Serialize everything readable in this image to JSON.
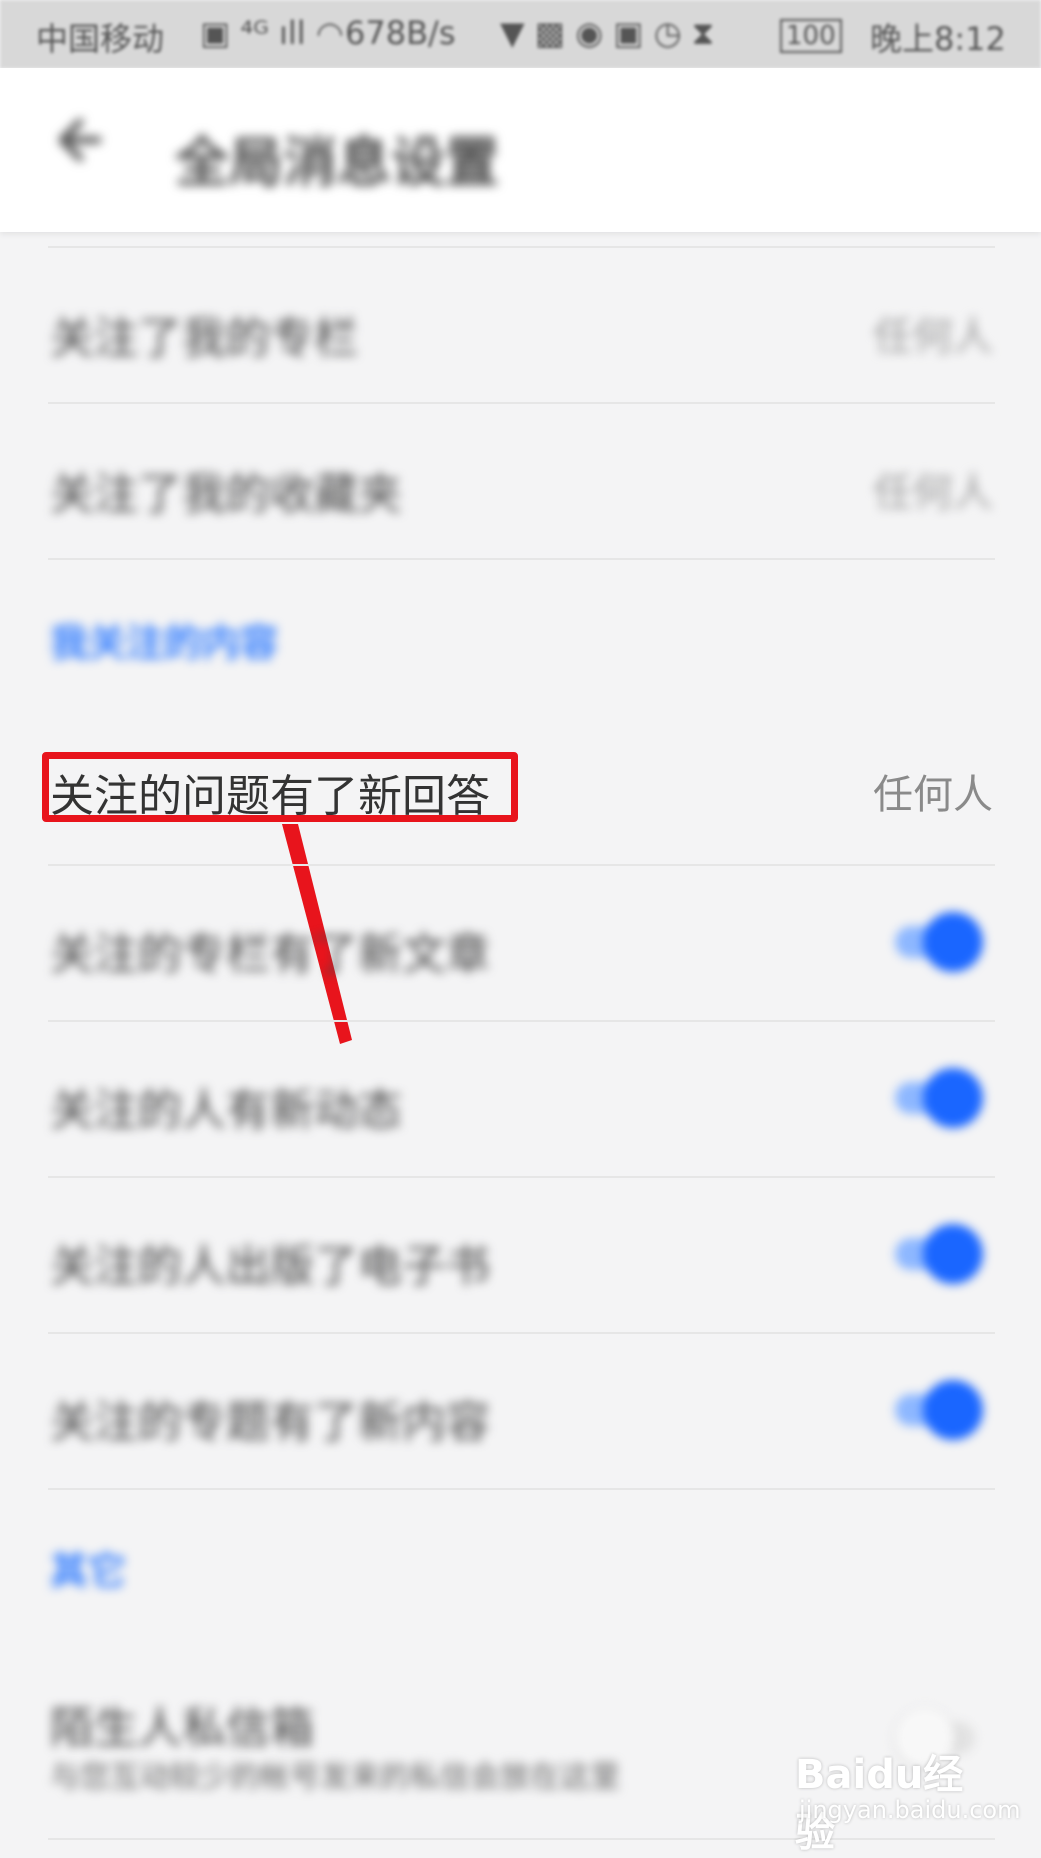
{
  "status_bar": {
    "carrier": "中国移动",
    "speed": "678B/s",
    "battery": "100",
    "time": "晚上8:12"
  },
  "header": {
    "title": "全局消息设置"
  },
  "rows_top": [
    {
      "label": "关注了我的专栏",
      "value": "任何人"
    },
    {
      "label": "关注了我的收藏夹",
      "value": "任何人"
    }
  ],
  "sections": {
    "followed_content": "我关注的内容",
    "other": "其它"
  },
  "focus_row": {
    "label": "关注的问题有了新回答",
    "value": "任何人"
  },
  "toggle_rows": [
    {
      "label": "关注的专栏有了新文章",
      "on": true
    },
    {
      "label": "关注的人有新动态",
      "on": true
    },
    {
      "label": "关注的人出版了电子书",
      "on": true
    },
    {
      "label": "关注的专题有了新内容",
      "on": true
    }
  ],
  "stranger_row": {
    "label": "陌生人私信箱",
    "description": "与您互动较少的帐号发来的私信会放在这里",
    "on": false
  },
  "watermark": {
    "brand": "Baidu经验",
    "url": "jingyan.baidu.com"
  },
  "colors": {
    "accent": "#1a66ff",
    "section": "#2f7bff",
    "highlight": "#e8141c"
  }
}
